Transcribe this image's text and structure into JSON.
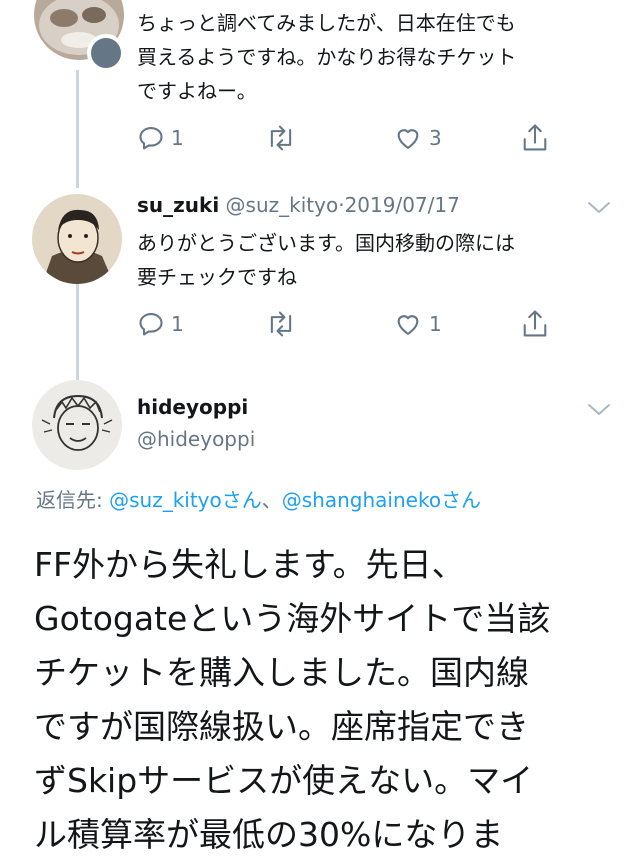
{
  "tweet1": {
    "lines": [
      "ちょっと調べてみましたが、日本在住でも",
      "買えるようですね。かなりお得なチケット",
      "ですよねー。"
    ],
    "reply_count": "1",
    "retweet_count": "",
    "like_count": "3"
  },
  "tweet2": {
    "display_name": "su_zuki",
    "handle": "@suz_kityo",
    "separator": "·",
    "date": "2019/07/17",
    "lines": [
      "ありがとうございます。国内移動の際には",
      "要チェックですね"
    ],
    "reply_count": "1",
    "retweet_count": "",
    "like_count": "1"
  },
  "main_tweet": {
    "display_name": "hideyoppi",
    "handle": "@hideyoppi",
    "reply_to_label": "返信先:",
    "reply_to_mention1": "@suz_kityoさん",
    "reply_to_separator": "、",
    "reply_to_mention2": "@shanghainekoさん",
    "lines": [
      "FF外から失礼します。先日、",
      "Gotogateという海外サイトで当該",
      "チケットを購入しました。国内線",
      "ですが国際線扱い。座席指定でき",
      "ずSkipサービスが使えない。マイ",
      "ル積算率が最低の30%になりま"
    ]
  },
  "colors": {
    "text": "#14171a",
    "secondary": "#657786",
    "link": "#1da1f2",
    "thread_line": "#ccd6dd"
  },
  "icons": [
    "reply-icon",
    "retweet-icon",
    "like-icon",
    "share-icon",
    "chevron-down-icon"
  ]
}
